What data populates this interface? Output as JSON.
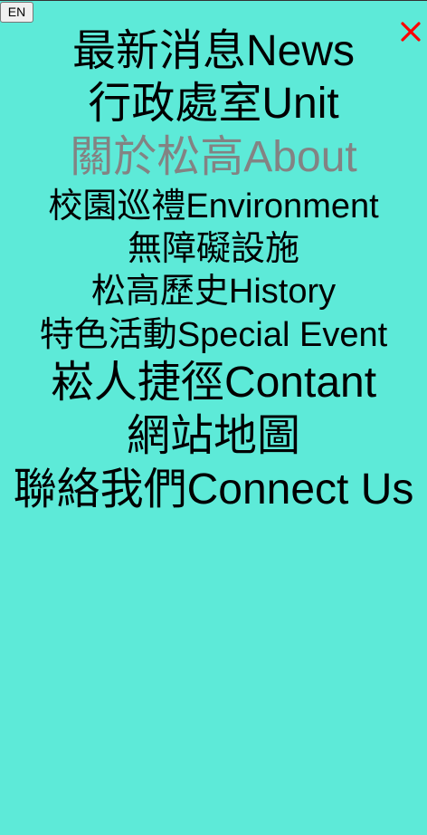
{
  "header": {
    "lang_button": "EN",
    "close_icon": "close-x-icon",
    "close_color": "#ff0000"
  },
  "menu": {
    "items": [
      {
        "zh": "最新消息",
        "en": "News"
      },
      {
        "zh": "行政處室",
        "en": "Unit"
      },
      {
        "zh": "關於松高",
        "en": "About"
      },
      {
        "zh": "校園巡禮",
        "en": "Environment"
      },
      {
        "zh": "無障礙設施",
        "en": ""
      },
      {
        "zh": "松高歷史",
        "en": "History"
      },
      {
        "zh": "特色活動",
        "en": "Special Event"
      },
      {
        "zh": "崧人捷徑",
        "en": "Contant"
      },
      {
        "zh": "網站地圖",
        "en": ""
      },
      {
        "zh": "聯絡我們",
        "en": "Connect Us"
      }
    ]
  },
  "colors": {
    "background": "#5dead8",
    "active_item": "#838383",
    "text": "#000000"
  }
}
